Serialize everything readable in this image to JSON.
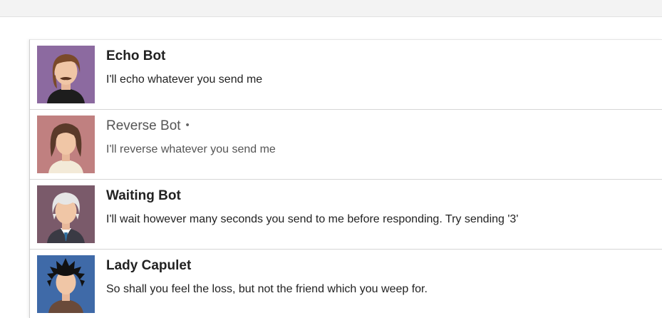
{
  "conversations": [
    {
      "name": "Echo Bot",
      "message": "I'll echo whatever you send me",
      "unread": false,
      "avatar_icon": "avatar-brown-hair-mustache",
      "avatar_bg": "#8c6aa0"
    },
    {
      "name": "Reverse Bot",
      "status_dot": "•",
      "message": "I'll reverse whatever you send me",
      "unread": true,
      "avatar_icon": "avatar-dark-hair-woman",
      "avatar_bg": "#c08080"
    },
    {
      "name": "Waiting Bot",
      "message": "I'll wait however many seconds you send to me before responding. Try sending '3'",
      "unread": false,
      "avatar_icon": "avatar-white-hair-suit",
      "avatar_bg": "#7a5a6a"
    },
    {
      "name": "Lady Capulet",
      "message": "So shall you feel the loss, but not the friend which you weep for.",
      "unread": false,
      "avatar_icon": "avatar-spiky-black-hair",
      "avatar_bg": "#3f6aa8"
    }
  ]
}
